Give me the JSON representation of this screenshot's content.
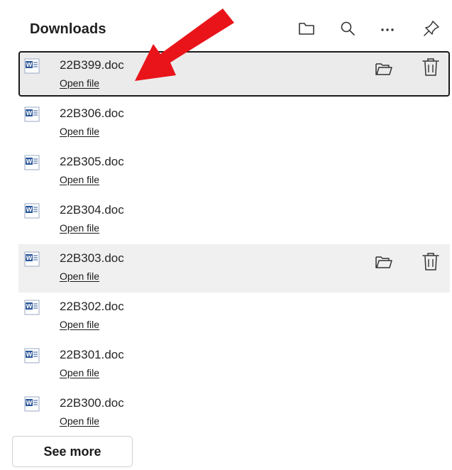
{
  "header": {
    "title": "Downloads",
    "open_folder_icon": "folder-icon",
    "search_icon": "search-icon",
    "more_icon": "more-options-icon",
    "pin_icon": "pin-icon"
  },
  "downloads": [
    {
      "name": "22B399.doc",
      "action": "Open file",
      "state": "selected"
    },
    {
      "name": "22B306.doc",
      "action": "Open file",
      "state": "normal"
    },
    {
      "name": "22B305.doc",
      "action": "Open file",
      "state": "normal"
    },
    {
      "name": "22B304.doc",
      "action": "Open file",
      "state": "normal"
    },
    {
      "name": "22B303.doc",
      "action": "Open file",
      "state": "hovered"
    },
    {
      "name": "22B302.doc",
      "action": "Open file",
      "state": "normal"
    },
    {
      "name": "22B301.doc",
      "action": "Open file",
      "state": "normal"
    },
    {
      "name": "22B300.doc",
      "action": "Open file",
      "state": "normal"
    }
  ],
  "footer": {
    "see_more_label": "See more"
  },
  "colors": {
    "annotation_arrow": "#e8141a",
    "word_icon_blue": "#2b579a"
  }
}
